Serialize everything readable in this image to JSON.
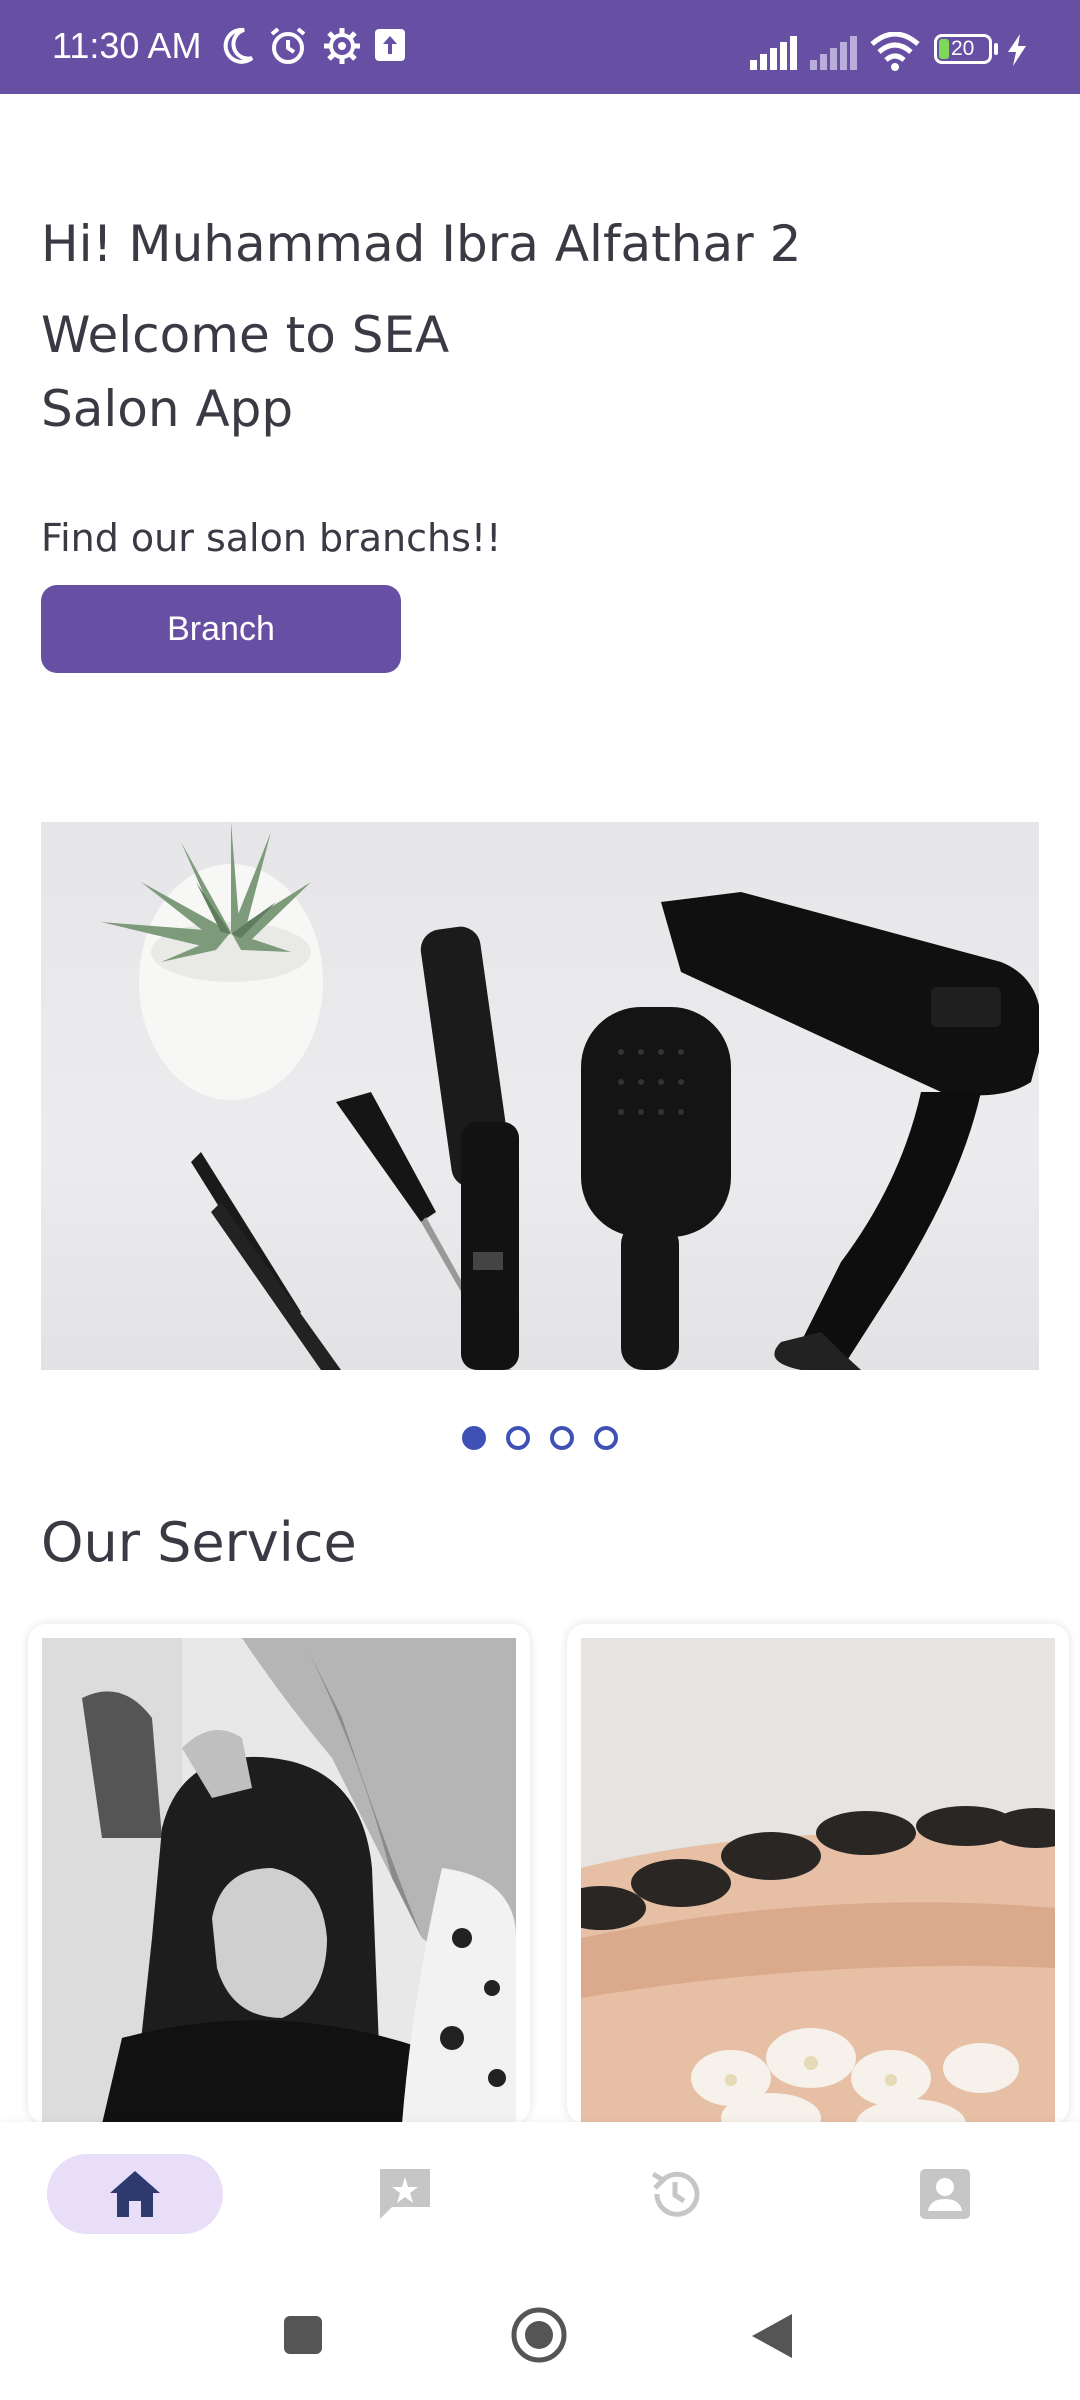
{
  "status_bar": {
    "time": "11:30 AM",
    "battery": "20",
    "icons": [
      "moon-icon",
      "alarm-icon",
      "settings-icon",
      "upload-icon",
      "signal-icon",
      "signal-icon-2",
      "wifi-icon",
      "battery-icon",
      "charging-icon"
    ]
  },
  "greeting": "Hi! Muhammad Ibra Alfathar 2",
  "welcome": "Welcome to SEA Salon App",
  "find_text": "Find our salon branchs!!",
  "branch_button": "Branch",
  "carousel": {
    "pages": 4,
    "active_index": 0
  },
  "section_title": "Our Service",
  "bottom_nav": {
    "items": [
      {
        "icon": "home-icon",
        "active": true
      },
      {
        "icon": "review-icon",
        "active": false
      },
      {
        "icon": "history-icon",
        "active": false
      },
      {
        "icon": "profile-icon",
        "active": false
      }
    ]
  },
  "colors": {
    "primary": "#6750a4",
    "nav_active_bg": "#e8def8",
    "dot": "#3f51b5",
    "text": "#3a3a44",
    "nav_inactive": "#c6c6c6",
    "nav_active_icon": "#2e3a6e"
  }
}
